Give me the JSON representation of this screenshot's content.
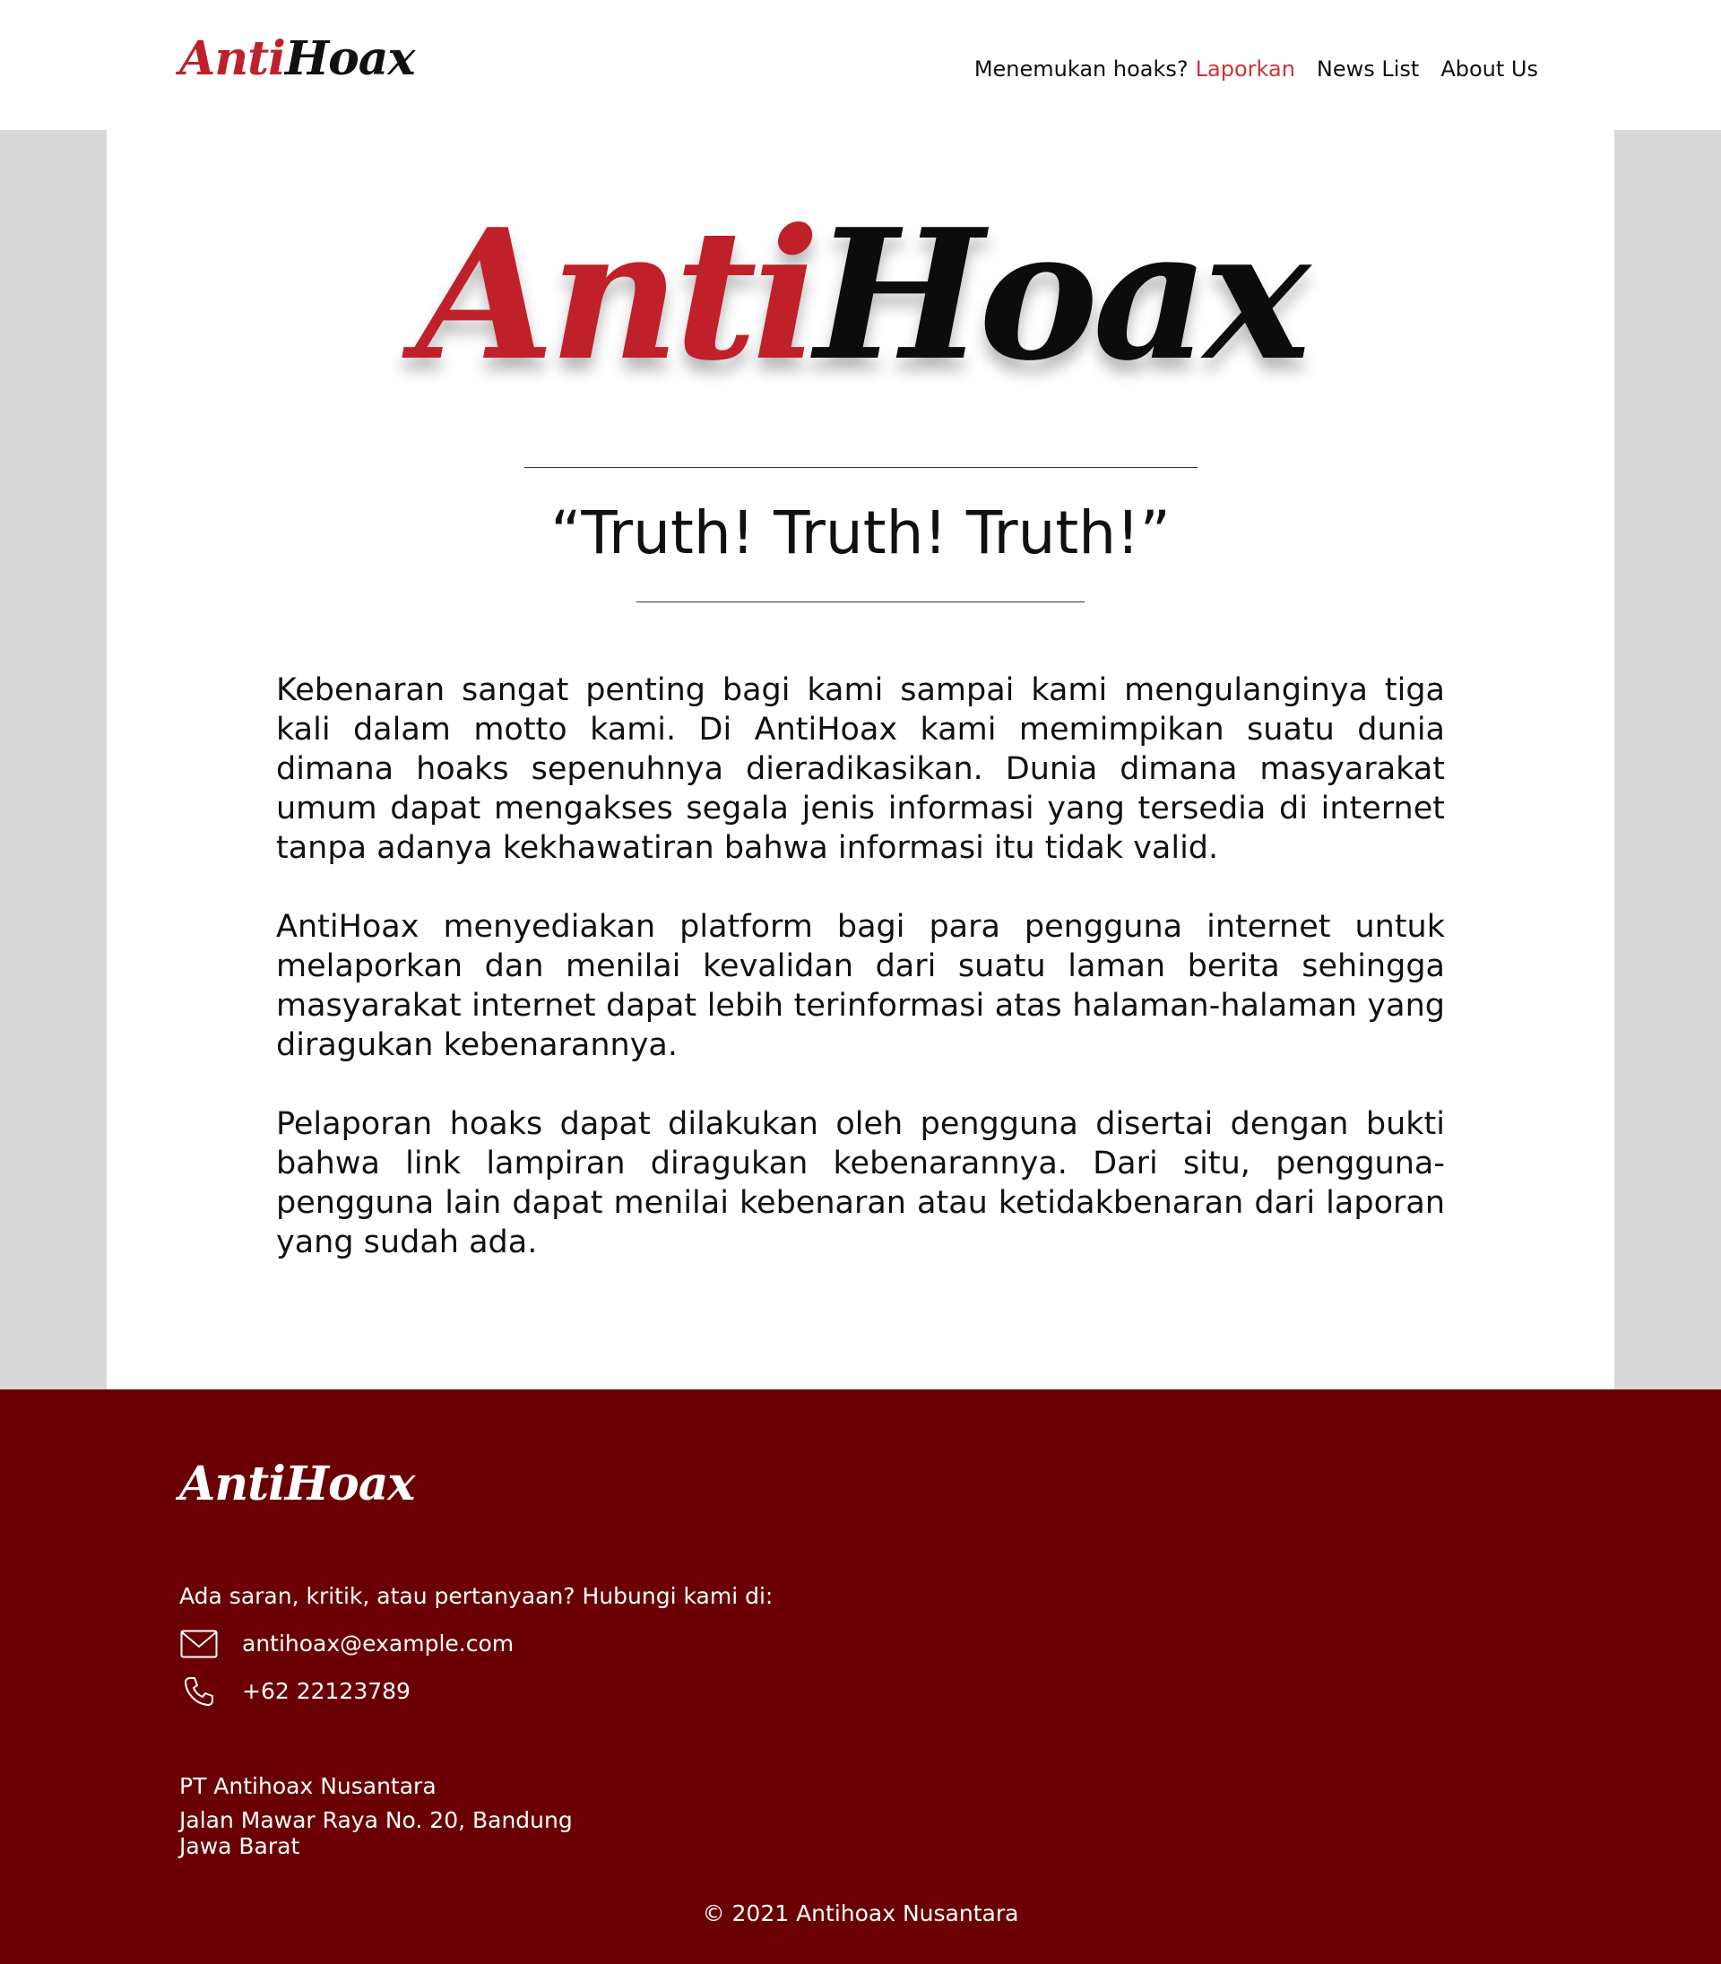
{
  "header": {
    "logo": {
      "anti": "Anti",
      "hoax": "Hoax"
    },
    "nav": {
      "question": "Menemukan hoaks?",
      "report_label": "Laporkan",
      "news_list_label": "News List",
      "about_label": "About Us"
    }
  },
  "hero": {
    "logo": {
      "anti": "Anti",
      "hoax": "Hoax"
    },
    "motto": "“Truth! Truth! Truth!”",
    "paragraphs": [
      "Kebenaran sangat penting bagi kami sampai kami mengulanginya tiga kali dalam motto kami. Di AntiHoax kami memimpikan suatu dunia dimana hoaks sepenuhnya dieradikasikan. Dunia dimana masyarakat umum dapat mengakses segala jenis informasi yang tersedia di internet tanpa adanya kekhawatiran bahwa informasi itu tidak valid.",
      "AntiHoax menyediakan platform bagi para pengguna internet untuk melaporkan dan menilai kevalidan dari suatu laman berita sehingga masyarakat internet dapat lebih terinformasi atas halaman-halaman yang diragukan kebenarannya.",
      "Pelaporan hoaks dapat dilakukan oleh pengguna disertai dengan bukti bahwa link lampiran diragukan kebenarannya. Dari situ, pengguna-pengguna lain dapat menilai kebenaran atau ketidakbenaran dari laporan yang sudah ada."
    ]
  },
  "footer": {
    "logo": "AntiHoax",
    "contact_intro": "Ada saran, kritik, atau pertanyaan? Hubungi kami di:",
    "email": "antihoax@example.com",
    "phone": "+62 22123789",
    "company": "PT Antihoax Nusantara",
    "address_line1": "Jalan Mawar Raya No. 20, Bandung",
    "address_line2": "Jawa Barat",
    "copyright": "© 2021 Antihoax Nusantara",
    "icons": {
      "email": "mail-icon",
      "phone": "phone-icon"
    }
  },
  "colors": {
    "brand_red": "#c0202a",
    "link_red": "#c9353b",
    "footer_bg": "#6a0004",
    "side_gray": "#d9d9d9"
  }
}
